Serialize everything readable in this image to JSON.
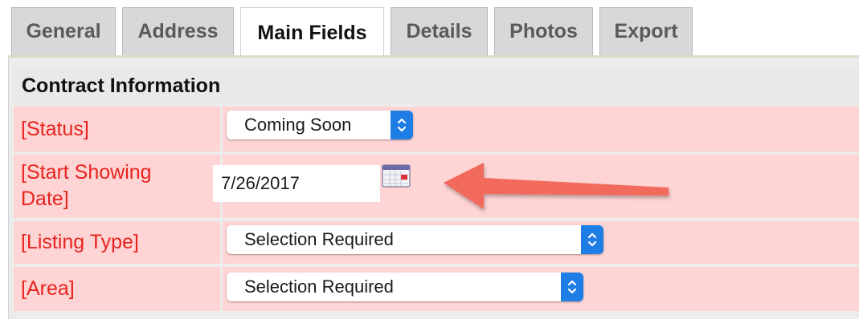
{
  "tabs": [
    {
      "label": "General",
      "active": false
    },
    {
      "label": "Address",
      "active": false
    },
    {
      "label": "Main Fields",
      "active": true
    },
    {
      "label": "Details",
      "active": false
    },
    {
      "label": "Photos",
      "active": false
    },
    {
      "label": "Export",
      "active": false
    }
  ],
  "section": {
    "title": "Contract Information"
  },
  "fields": {
    "status": {
      "label": "[Status]",
      "value": "Coming Soon"
    },
    "start_showing_date": {
      "label_line1": "[Start Showing",
      "label_line2": "Date]",
      "value": "7/26/2017"
    },
    "listing_type": {
      "label": "[Listing Type]",
      "value": "Selection Required"
    },
    "area": {
      "label": "[Area]",
      "value": "Selection Required"
    }
  },
  "icons": {
    "calendar": "calendar-icon",
    "annotation_arrow": "arrow-left-icon",
    "select_stepper": "chevron-up-down-icon"
  },
  "colors": {
    "label_text": "#e8231f",
    "row_background": "#ffd4d4",
    "stepper_blue": "#1f7de6",
    "arrow": "#f26b5b",
    "tab_inactive": "#d8d8d8"
  }
}
